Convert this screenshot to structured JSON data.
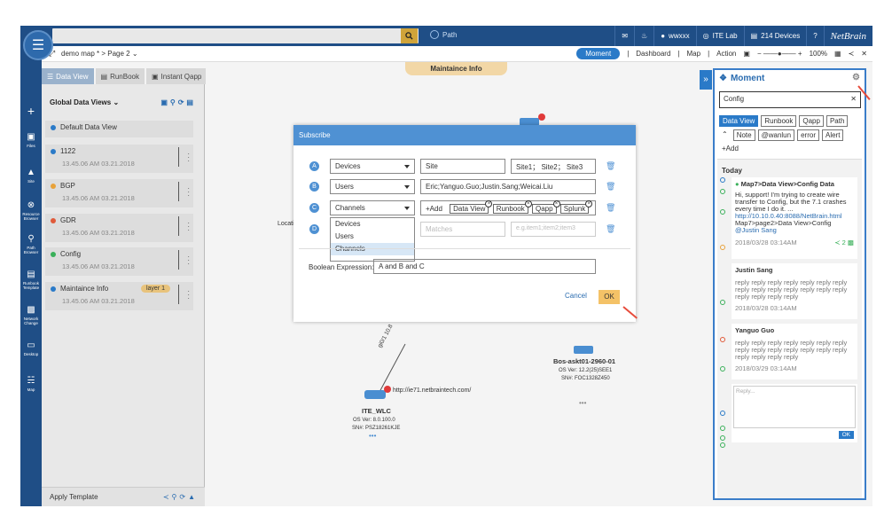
{
  "topbar": {
    "path_label": "Path",
    "user": "wwxxx",
    "lab": "ITE Lab",
    "devices": "214 Devices",
    "help": "?",
    "logo": "NetBrain"
  },
  "subbar": {
    "map_title": "demo map * > Page 2",
    "moment": "Moment",
    "dashboard": "Dashboard",
    "map": "Map",
    "action": "Action",
    "zoom": "100%"
  },
  "tabs": [
    {
      "label": "Data View"
    },
    {
      "label": "RunBook"
    },
    {
      "label": "Instant Qapp"
    }
  ],
  "rail": [
    {
      "label": "Files",
      "icon": "folder-icon"
    },
    {
      "label": "Site",
      "icon": "site-icon"
    },
    {
      "label": "Resource Browser",
      "icon": "resource-icon"
    },
    {
      "label": "Path Browser",
      "icon": "path-icon"
    },
    {
      "label": "Runbook Template",
      "icon": "runbook-icon"
    },
    {
      "label": "Network Change",
      "icon": "network-change-icon"
    },
    {
      "label": "Desktop",
      "icon": "desktop-icon"
    },
    {
      "label": "Map",
      "icon": "map-icon"
    }
  ],
  "leftpanel": {
    "title": "Global Data Views",
    "default_view": "Default Data View",
    "apply_template": "Apply Template",
    "views": [
      {
        "name": "1122",
        "date": "13.45.06 AM 03.21.2018",
        "color": "#2a7ac8"
      },
      {
        "name": "BGP",
        "date": "13.45.06 AM 03.21.2018",
        "color": "#e8a23a"
      },
      {
        "name": "GDR",
        "date": "13.45.06 AM 03.21.2018",
        "color": "#e05a3a"
      },
      {
        "name": "Config",
        "date": "13.45.06 AM 03.21.2018",
        "color": "#3ab05a"
      },
      {
        "name": "Maintaince Info",
        "date": "13.45.06 AM 03.21.2018",
        "color": "#2a7ac8",
        "layer": "layer 1"
      }
    ]
  },
  "canvas": {
    "maint_tab": "Maintaince Info",
    "location_label": "Locati",
    "device1": {
      "name": "ITE_WLC",
      "os": "OS Ver: 8.0.100.0",
      "sn": "SN#: PSZ18261KJE",
      "url": "http://ie71.netbraintech.com/"
    },
    "device2": {
      "name": "Bos-askt01-2960-01",
      "os": "OS Ver: 12.2(25)SEE1",
      "sn": "SN#: FOC1328Z450"
    },
    "link_label": "gi0/1 10.8"
  },
  "rightpanel": {
    "title": "Moment",
    "search_value": "Config",
    "tags": [
      {
        "label": "Data View",
        "on": true
      },
      {
        "label": "Runbook",
        "on": false
      },
      {
        "label": "Qapp",
        "on": false
      },
      {
        "label": "Path",
        "on": false
      },
      {
        "label": "Note",
        "on": false
      },
      {
        "label": "@wanlun",
        "on": false
      },
      {
        "label": "error",
        "on": false
      },
      {
        "label": "Alert",
        "on": false
      },
      {
        "label": "+Add",
        "on": false
      }
    ],
    "today": "Today",
    "post1": {
      "title": "Map7>Data View>Config Data",
      "body": "Hi, support! I'm trying to create wire transfer to Config, but the 7.1 crashes every time I do it. ...",
      "link": "http://10.10.0.40:8088/NetBrain.html",
      "path": "Map7>page2>Data View>Config",
      "mention": "@Justin Sang",
      "time": "2018/03/28 03:14AM",
      "count": "2"
    },
    "post2": {
      "author": "Justin Sang",
      "body": "reply reply reply reply reply reply reply reply reply reply reply reply reply reply reply reply reply reply",
      "time": "2018/03/28 03:14AM"
    },
    "post3": {
      "author": "Yanguo Guo",
      "body": "reply reply reply reply reply reply reply reply reply reply reply reply reply reply reply reply reply reply",
      "time": "2018/03/29 03:14AM"
    },
    "reply_placeholder": "Reply...",
    "ok": "OK"
  },
  "modal": {
    "title": "Subscribe",
    "rows": [
      {
        "letter": "A",
        "type": "Devices",
        "value": "Site",
        "extra": "Site1； Site2； Site3"
      },
      {
        "letter": "B",
        "type": "Users",
        "value": "Eric;Yanguo.Guo;Justin.Sang;Weicai.Liu"
      },
      {
        "letter": "C",
        "type": "Channels",
        "add": "+Add",
        "chips": [
          "Data View",
          "Runbook",
          "Qapp",
          "Splunk"
        ]
      },
      {
        "letter": "D",
        "placeholder1": "Matches",
        "placeholder2": "e.g.item1;item2;item3"
      }
    ],
    "dropdown": [
      "Devices",
      "Users",
      "Channels"
    ],
    "bool_label": "Boolean Expression:",
    "bool_value": "A and B and C",
    "cancel": "Cancel",
    "ok": "OK"
  }
}
